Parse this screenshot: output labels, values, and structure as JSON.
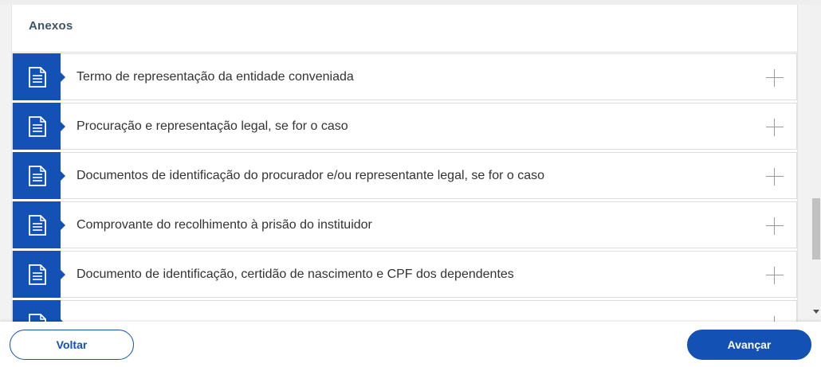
{
  "panel": {
    "title": "Anexos"
  },
  "attachments": [
    {
      "label": "Termo de representação da entidade conveniada"
    },
    {
      "label": "Procuração e representação legal, se for o caso"
    },
    {
      "label": "Documentos de identificação do procurador e/ou representante legal, se for o caso"
    },
    {
      "label": "Comprovante do recolhimento à prisão do instituidor"
    },
    {
      "label": "Documento de identificação, certidão de nascimento e CPF dos dependentes"
    },
    {
      "label": ""
    }
  ],
  "footer": {
    "back_label": "Voltar",
    "next_label": "Avançar"
  },
  "colors": {
    "primary": "#1351b4",
    "title": "#3e5566"
  },
  "icons": {
    "attachment": "document-icon",
    "expand": "plus-icon"
  }
}
